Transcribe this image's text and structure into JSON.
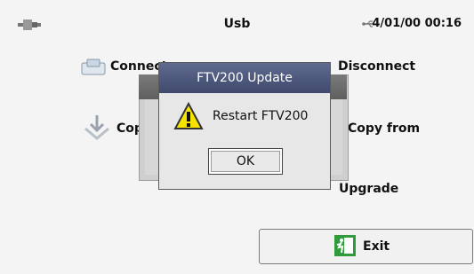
{
  "status": {
    "title": "Usb",
    "datetime": "4/01/00 00:16"
  },
  "menu": {
    "connect": "Connect",
    "disconnect": "Disconnect",
    "copy_to": "Copy to",
    "copy_from": "Copy from",
    "upgrade": "Upgrade"
  },
  "dialog": {
    "title": "FTV200 Update",
    "message": "Restart FTV200",
    "ok_label": "OK"
  },
  "exit": {
    "label": "Exit"
  },
  "icons": {
    "plug": "usb-plug-icon",
    "usb_small": "usb-icon",
    "connect": "device-icon",
    "copy": "download-arrow-icon",
    "warning": "warning-icon",
    "exit": "exit-icon"
  }
}
